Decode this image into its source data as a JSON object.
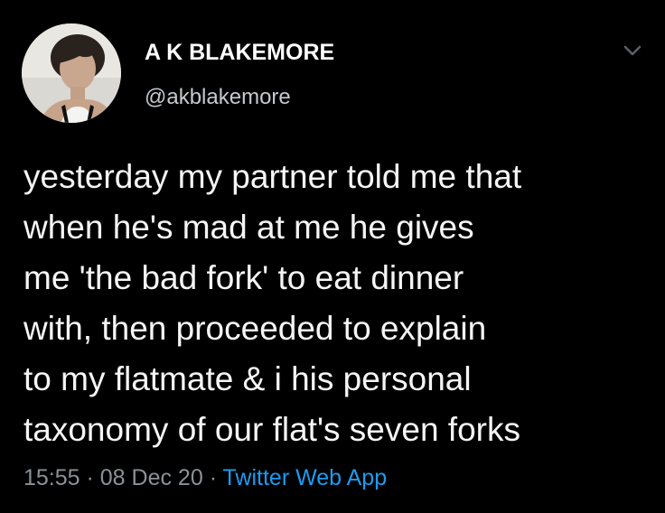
{
  "tweet": {
    "author": {
      "display_name": "A K BLAKEMORE",
      "handle": "@akblakemore"
    },
    "text": "yesterday my partner told me that\nwhen he's mad at me he gives\nme 'the bad fork' to eat dinner\nwith, then proceeded to explain\nto my flatmate & i his personal\ntaxonomy of our flat's seven forks",
    "timestamp": "15:55 · 08 Dec 20",
    "separator": "·",
    "source": "Twitter Web App",
    "menu_icon": "chevron-down-icon"
  },
  "colors": {
    "background": "#000000",
    "text": "#ffffff",
    "secondary_text": "#8b9196",
    "link": "#1d9bf0"
  }
}
